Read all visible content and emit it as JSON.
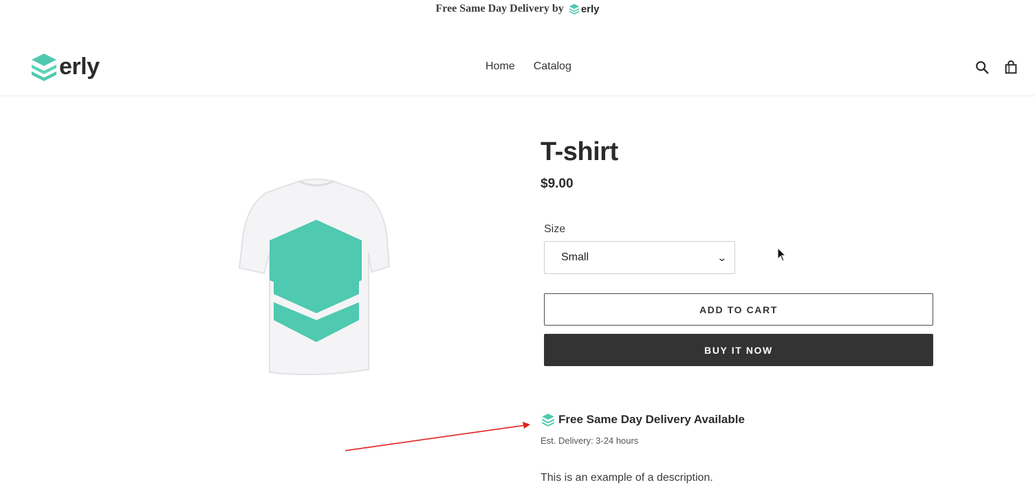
{
  "announcement": {
    "text": "Free Same Day Delivery by",
    "brand": "erly"
  },
  "header": {
    "logo_text": "erly",
    "nav": [
      {
        "label": "Home"
      },
      {
        "label": "Catalog"
      }
    ],
    "icons": [
      "search-icon",
      "cart-icon"
    ]
  },
  "product": {
    "title": "T-shirt",
    "price": "$9.00",
    "size_label": "Size",
    "size_value": "Small",
    "add_to_cart": "ADD TO CART",
    "buy_now": "BUY IT NOW",
    "delivery_title": "Free Same Day Delivery Available",
    "delivery_est": "Est. Delivery: 3-24 hours",
    "description": "This is an example of a description."
  },
  "colors": {
    "brand_teal": "#4fc9b0",
    "buy_button": "#333333",
    "annotation_arrow": "#e02020"
  }
}
